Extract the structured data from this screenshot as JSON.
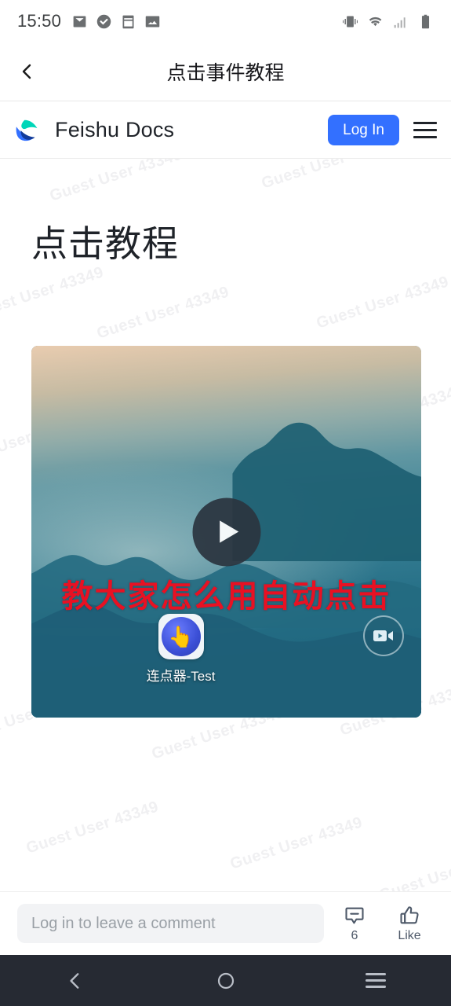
{
  "status_bar": {
    "time": "15:50",
    "left_icons": [
      "mail-icon",
      "check-circle-icon",
      "calendar-icon",
      "photo-icon"
    ],
    "right_icons": [
      "vibrate-icon",
      "wifi-icon",
      "signal-icon",
      "battery-icon"
    ]
  },
  "title_bar": {
    "back_icon": "chevron-left-icon",
    "title": "点击事件教程"
  },
  "web_header": {
    "logo_icon": "feishu-logo-icon",
    "brand": "Feishu Docs",
    "login_label": "Log In",
    "menu_icon": "hamburger-menu-icon",
    "accent_color": "#3370ff"
  },
  "document": {
    "title": "点击教程",
    "watermark": "Guest User 43349"
  },
  "video": {
    "overlay_text": "教大家怎么用自动点击",
    "overlay_text_color": "#e81123",
    "play_icon": "play-icon",
    "app_icon": "click-app-icon",
    "app_icon_glyph": "👆",
    "app_label": "连点器-Test",
    "badge_icon": "video-camera-icon"
  },
  "comment_bar": {
    "placeholder": "Log in to leave a comment",
    "value": "",
    "comment_icon": "comment-icon",
    "comment_count": "6",
    "like_icon": "thumbs-up-icon",
    "like_label": "Like"
  },
  "nav_bar": {
    "back_icon": "nav-back-icon",
    "home_icon": "nav-home-icon",
    "recents_icon": "nav-recents-icon"
  }
}
